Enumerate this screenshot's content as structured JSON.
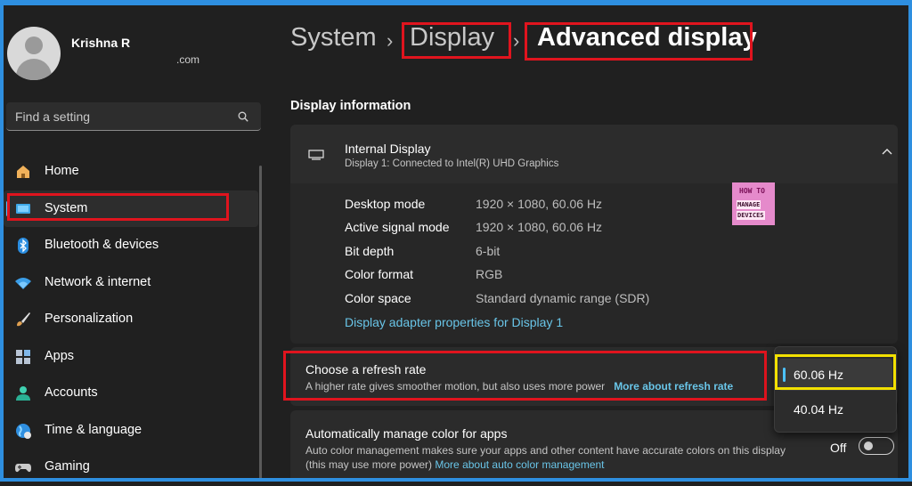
{
  "user": {
    "name": "Krishna R",
    "email": ".com"
  },
  "search": {
    "placeholder": "Find a setting"
  },
  "nav": {
    "items": [
      {
        "label": "Home",
        "icon": "home-icon"
      },
      {
        "label": "System",
        "icon": "system-icon",
        "active": true
      },
      {
        "label": "Bluetooth & devices",
        "icon": "bluetooth-icon"
      },
      {
        "label": "Network & internet",
        "icon": "wifi-icon"
      },
      {
        "label": "Personalization",
        "icon": "brush-icon"
      },
      {
        "label": "Apps",
        "icon": "apps-icon"
      },
      {
        "label": "Accounts",
        "icon": "accounts-icon"
      },
      {
        "label": "Time & language",
        "icon": "globe-icon"
      },
      {
        "label": "Gaming",
        "icon": "gamepad-icon"
      }
    ]
  },
  "breadcrumb": {
    "root": "System",
    "parent": "Display",
    "current": "Advanced display",
    "separator": "›"
  },
  "section": {
    "title": "Display information"
  },
  "display_card": {
    "title": "Internal Display",
    "subtitle": "Display 1: Connected to Intel(R) UHD Graphics",
    "rows": [
      {
        "key": "Desktop mode",
        "value": "1920 × 1080, 60.06 Hz"
      },
      {
        "key": "Active signal mode",
        "value": "1920 × 1080, 60.06 Hz"
      },
      {
        "key": "Bit depth",
        "value": "6-bit"
      },
      {
        "key": "Color format",
        "value": "RGB"
      },
      {
        "key": "Color space",
        "value": "Standard dynamic range (SDR)"
      }
    ],
    "adapter_link": "Display adapter properties for Display 1"
  },
  "logo": {
    "line1": "HOW TO",
    "line2": "MANAGE",
    "line3": "DEVICES"
  },
  "refresh": {
    "title": "Choose a refresh rate",
    "description": "A higher rate gives smoother motion, but also uses more power",
    "link": "More about refresh rate",
    "options": [
      "60.06 Hz",
      "40.04 Hz"
    ],
    "selected": "60.06 Hz"
  },
  "color_management": {
    "title": "Automatically manage color for apps",
    "description": "Auto color management makes sure your apps and other content have accurate colors on this display (this may use more power)",
    "link": "More about auto color management",
    "toggle_label": "Off",
    "toggle_on": false
  },
  "colors": {
    "accent": "#4cc2ff",
    "highlight_red": "#e0141e",
    "highlight_yellow": "#f2e000",
    "link": "#69c5e8"
  }
}
